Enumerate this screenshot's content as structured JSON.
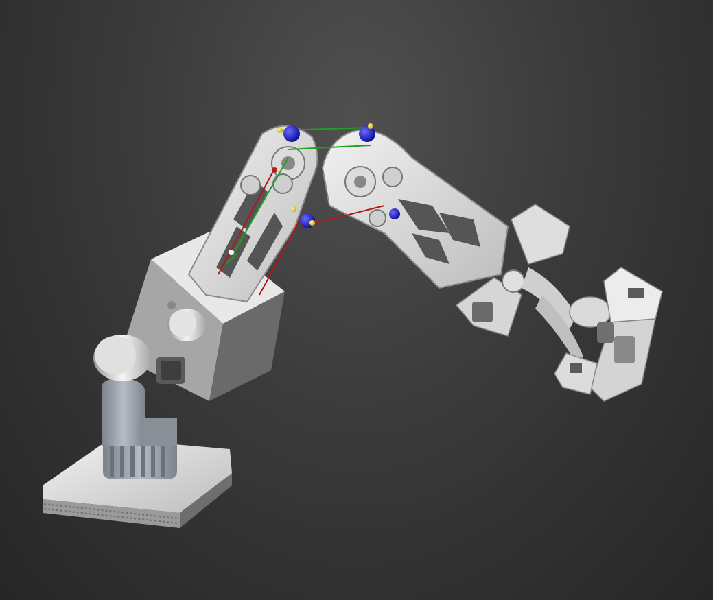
{
  "viewport": {
    "background_top": "#505050",
    "background_bottom": "#262626"
  },
  "model": {
    "part_color_light": "#e6e6e6",
    "part_color_mid": "#b4b4b4",
    "part_color_dark": "#7a7a7a",
    "base_color": "#9aa0a8",
    "motor_color": "#d8d8d8",
    "joint_marker_blue": "#1414c8",
    "joint_marker_yellow": "#e8e020",
    "tendon_green": "#20a020",
    "tendon_red": "#b01818"
  },
  "icons": {
    "joint_marker": "sphere-icon",
    "motor": "cylinder-icon"
  }
}
